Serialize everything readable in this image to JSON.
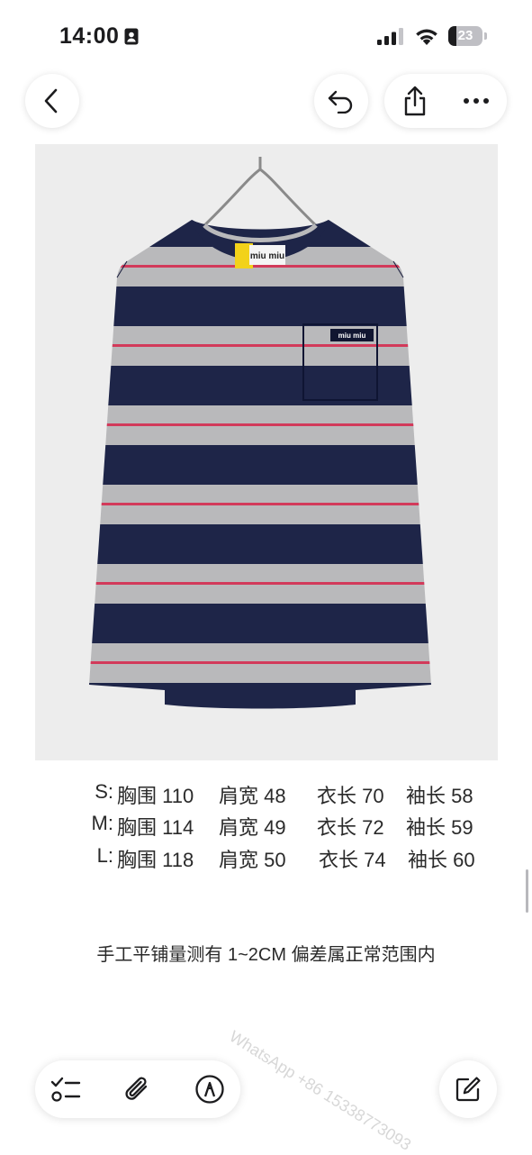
{
  "status_bar": {
    "time": "14:00",
    "battery_level": "23",
    "battery_fraction": 0.23,
    "icons": [
      "id-card-icon",
      "signal-icon",
      "wifi-icon",
      "battery-icon"
    ]
  },
  "navigation": {
    "back_icon": "chevron-left-icon",
    "actions": [
      "undo-icon",
      "share-icon",
      "more-icon"
    ]
  },
  "photo": {
    "description_icon": "photo-image",
    "tag_text": "miu miu",
    "pocket_logo": "miu miu",
    "colors": {
      "background": "#ededed",
      "navy": "#1e2548",
      "grey": "#b9b9bb",
      "red": "#d23a5a"
    }
  },
  "size_table": [
    {
      "size": "S:",
      "chest": "胸围 110",
      "shoulder": "肩宽 48",
      "length": "衣长 70",
      "sleeve": "袖长 58"
    },
    {
      "size": "M:",
      "chest": "胸围 114",
      "shoulder": "肩宽 49",
      "length": "衣长 72",
      "sleeve": "袖长 59"
    },
    {
      "size": "L:",
      "chest": "胸围 118",
      "shoulder": "肩宽 50",
      "length": "衣长 74",
      "sleeve": "袖长 60"
    }
  ],
  "note": "手工平铺量测有 1~2CM 偏差属正常范围内",
  "watermark": "WhatsApp +86 15338773093",
  "toolbar": {
    "icons": [
      "checklist-icon",
      "paperclip-icon",
      "markup-pen-icon"
    ],
    "compose_icon": "compose-icon"
  }
}
